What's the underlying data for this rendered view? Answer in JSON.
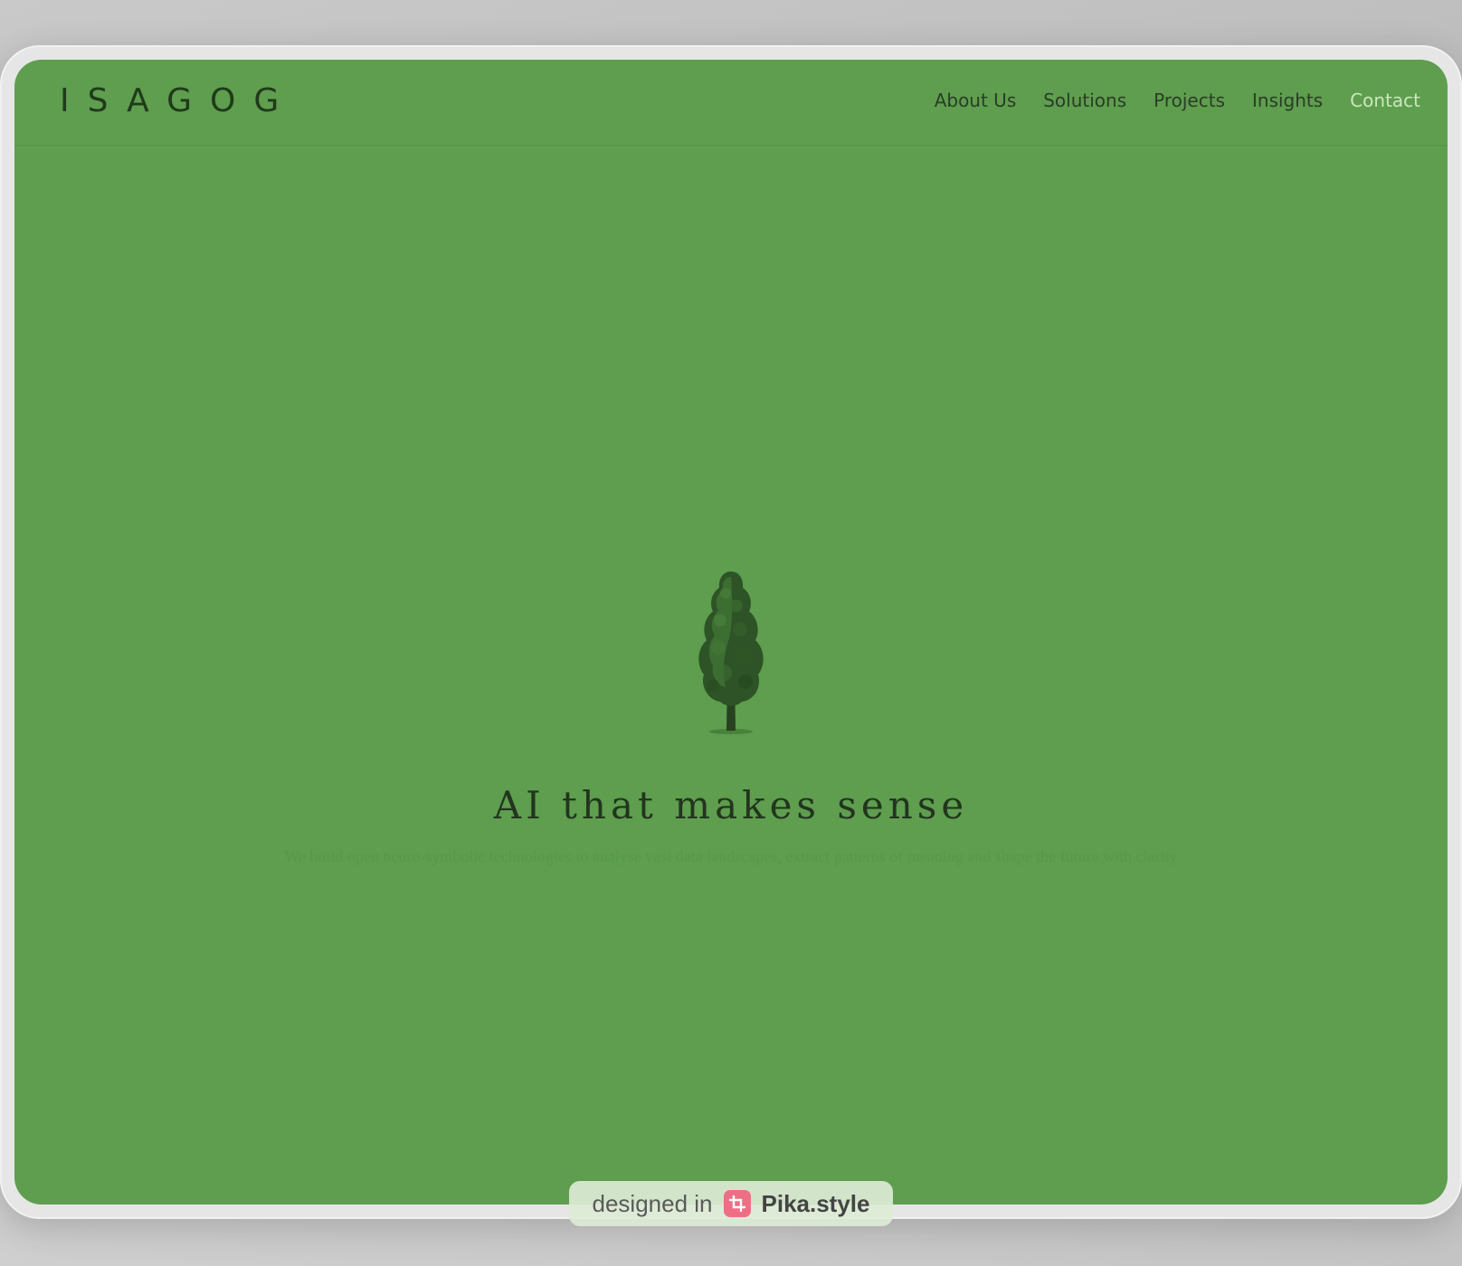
{
  "site": {
    "logo": "ISAGOG",
    "nav": [
      {
        "label": "About Us"
      },
      {
        "label": "Solutions"
      },
      {
        "label": "Projects"
      },
      {
        "label": "Insights"
      },
      {
        "label": "Contact"
      }
    ]
  },
  "hero": {
    "icon": "tree-icon",
    "headline": "AI that makes sense",
    "subtext": "We build open neuro-symbolic technologies to analyse vast data landscapes, extract patterns of meaning and shape the future with clarity"
  },
  "watermark": {
    "prefix": "designed in",
    "brand": "Pika.style",
    "icon": "pika-crop-icon"
  },
  "colors": {
    "page_background": "#5e9e4e",
    "nav_text": "#2a3d25",
    "contact_link": "#c9e8bb",
    "headline": "#22351e",
    "tree_dark": "#2d5326",
    "pika_icon": "#ee6f85"
  }
}
